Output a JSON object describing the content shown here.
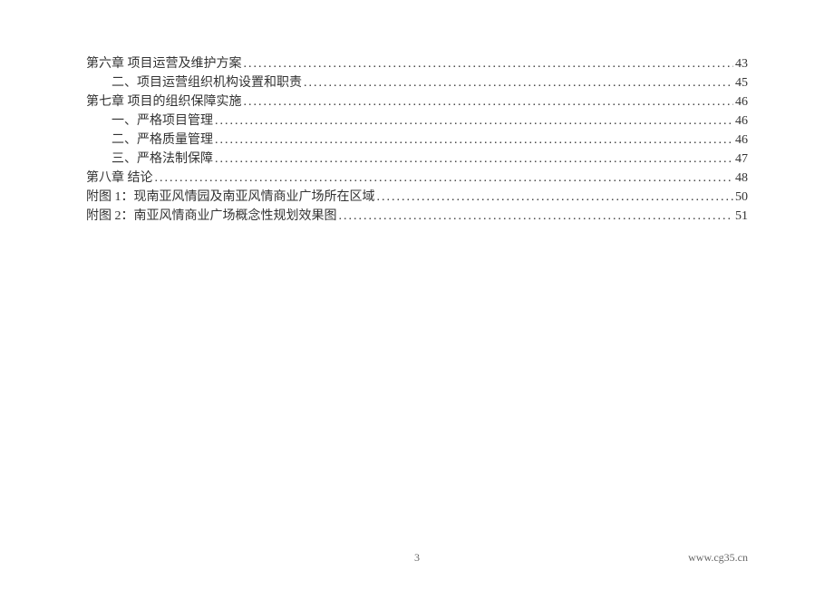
{
  "toc": [
    {
      "label": "第六章   项目运营及维护方案",
      "page": "43",
      "level": 0
    },
    {
      "label": "二、项目运营组织机构设置和职责",
      "page": "45",
      "level": 1
    },
    {
      "label": "第七章   项目的组织保障实施",
      "page": "46",
      "level": 0
    },
    {
      "label": "一、严格项目管理",
      "page": "46",
      "level": 1
    },
    {
      "label": "二、严格质量管理",
      "page": "46",
      "level": 1
    },
    {
      "label": "三、严格法制保障",
      "page": "47",
      "level": 1
    },
    {
      "label": "第八章     结论",
      "page": "48",
      "level": 0
    },
    {
      "label": "附图 1：现南亚风情园及南亚风情商业广场所在区域",
      "page": "50",
      "level": 0
    },
    {
      "label": "附图 2：南亚风情商业广场概念性规划效果图",
      "page": "51",
      "level": 0
    }
  ],
  "footer": {
    "pageNumber": "3",
    "url": "www.cg35.cn"
  }
}
